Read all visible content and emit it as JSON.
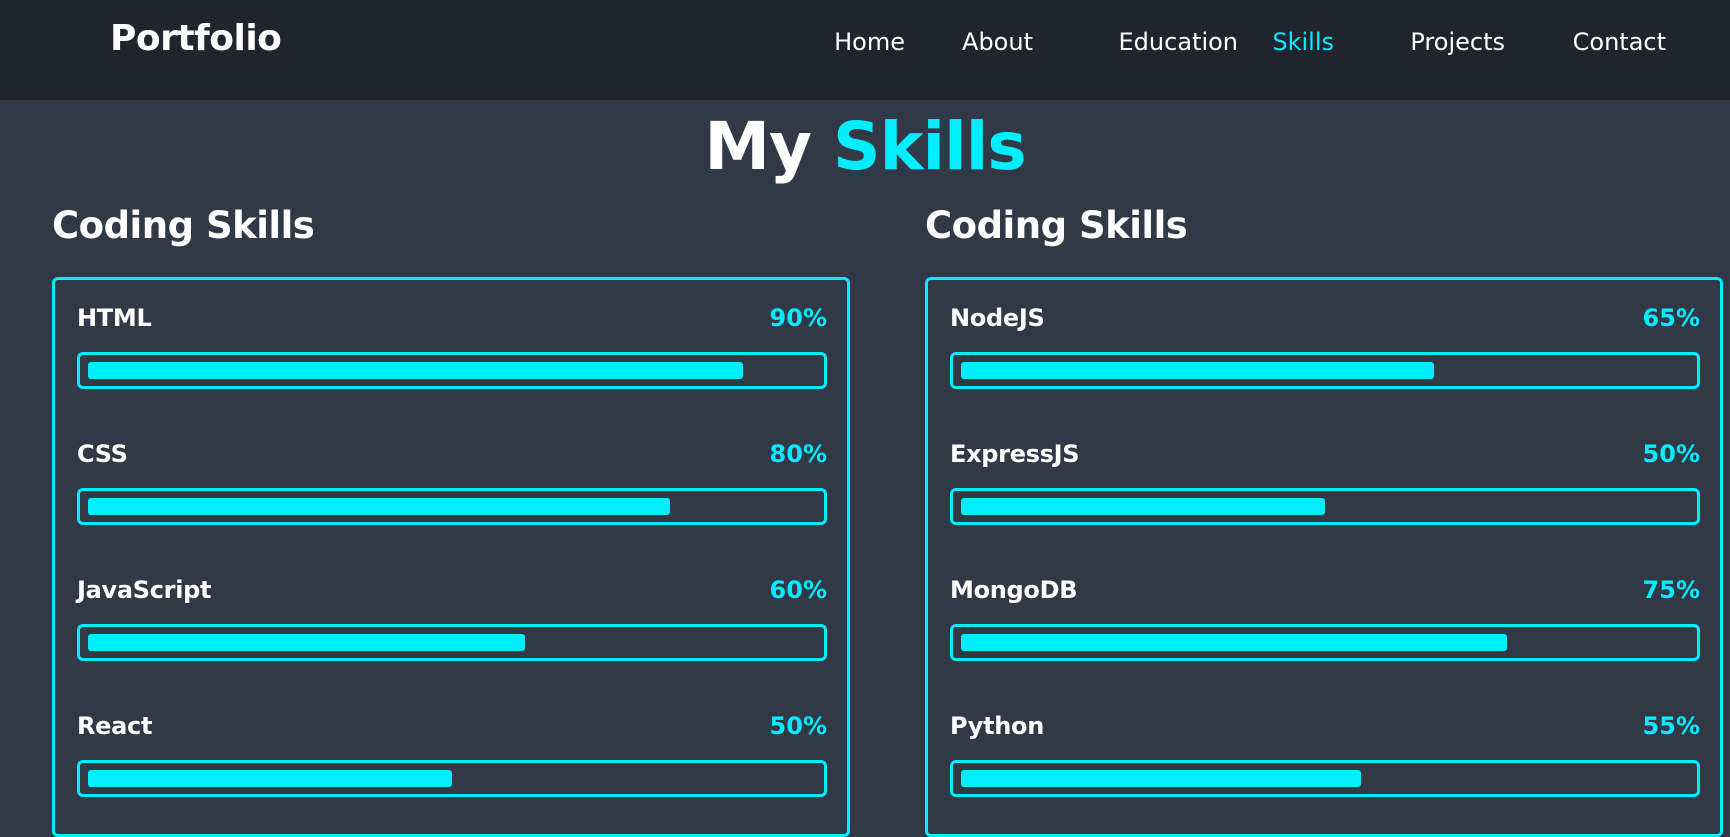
{
  "header": {
    "logo": "Portfolio",
    "nav": [
      {
        "label": "Home",
        "active": false
      },
      {
        "label": "About",
        "active": false
      },
      {
        "label": "Education",
        "active": false
      },
      {
        "label": "Skills",
        "active": true
      },
      {
        "label": "Projects",
        "active": false
      },
      {
        "label": "Contact",
        "active": false
      }
    ]
  },
  "page_title": {
    "plain": "My",
    "accent": "Skills"
  },
  "colors": {
    "accent": "#00eeff",
    "background": "#323946",
    "header_bg": "#1f242d",
    "text": "#ffffff"
  },
  "columns": [
    {
      "title": "Coding Skills",
      "skills": [
        {
          "name": "HTML",
          "percent": "90%",
          "value": 90
        },
        {
          "name": "CSS",
          "percent": "80%",
          "value": 80
        },
        {
          "name": "JavaScript",
          "percent": "60%",
          "value": 60
        },
        {
          "name": "React",
          "percent": "50%",
          "value": 50
        }
      ]
    },
    {
      "title": "Coding Skills",
      "skills": [
        {
          "name": "NodeJS",
          "percent": "65%",
          "value": 65
        },
        {
          "name": "ExpressJS",
          "percent": "50%",
          "value": 50
        },
        {
          "name": "MongoDB",
          "percent": "75%",
          "value": 75
        },
        {
          "name": "Python",
          "percent": "55%",
          "value": 55
        }
      ]
    }
  ]
}
